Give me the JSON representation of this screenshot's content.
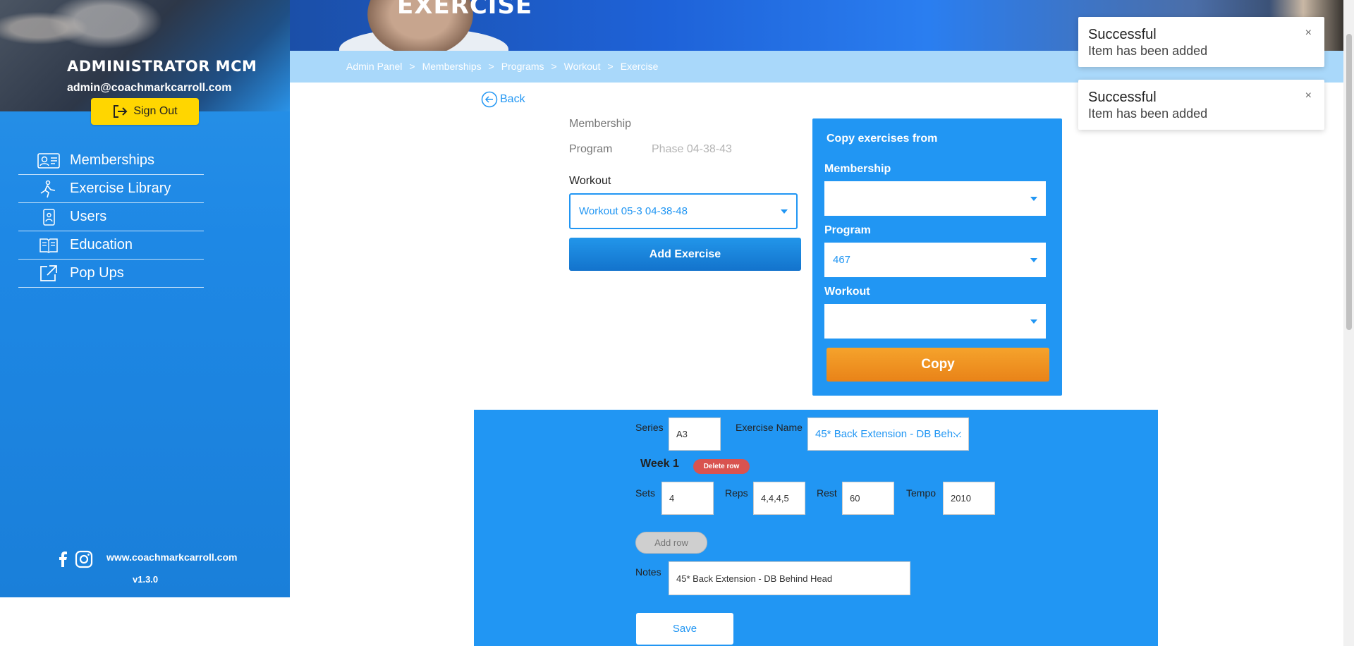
{
  "sidebar": {
    "admin_name": "ADMINISTRATOR MCM",
    "admin_email": "admin@coachmarkcarroll.com",
    "signout_label": "Sign Out",
    "items": [
      {
        "label": "Memberships",
        "icon": "id-card-icon"
      },
      {
        "label": "Exercise Library",
        "icon": "runner-icon"
      },
      {
        "label": "Users",
        "icon": "user-icon"
      },
      {
        "label": "Education",
        "icon": "book-icon"
      },
      {
        "label": "Pop Ups",
        "icon": "external-link-icon"
      }
    ],
    "site_url": "www.coachmarkcarroll.com",
    "version": "v1.3.0"
  },
  "header": {
    "title": "EXERCISE",
    "breadcrumb": [
      "Admin Panel",
      "Memberships",
      "Programs",
      "Workout",
      "Exercise"
    ],
    "breadcrumb_sep": ">"
  },
  "back_label": "Back",
  "form": {
    "membership_label": "Membership",
    "program_label": "Program",
    "program_value": "Phase 04-38-43",
    "workout_label": "Workout",
    "workout_value": "Workout 05-3 04-38-48",
    "add_exercise_label": "Add Exercise"
  },
  "copy_panel": {
    "title": "Copy exercises from",
    "membership_label": "Membership",
    "membership_value": "",
    "program_label": "Program",
    "program_value": "467",
    "workout_label": "Workout",
    "workout_value": "",
    "copy_label": "Copy"
  },
  "exercise": {
    "series_label": "Series",
    "series_value": "A3",
    "name_label": "Exercise Name",
    "name_value": "45* Back Extension - DB Beh...",
    "week_label": "Week 1",
    "delete_row_label": "Delete row",
    "sets_label": "Sets",
    "sets_value": "4",
    "reps_label": "Reps",
    "reps_value": "4,4,4,5",
    "rest_label": "Rest",
    "rest_value": "60",
    "tempo_label": "Tempo",
    "tempo_value": "2010",
    "add_row_label": "Add row",
    "notes_label": "Notes",
    "notes_value": "45* Back Extension - DB Behind Head",
    "save_label": "Save"
  },
  "toasts": [
    {
      "title": "Successful",
      "message": "Item has been added",
      "close": "×"
    },
    {
      "title": "Successful",
      "message": "Item has been added",
      "close": "×"
    }
  ],
  "colors": {
    "primary": "#2196f3",
    "signout": "#ffd600",
    "copy_button": "#f08a1c",
    "delete_row": "#d9534f",
    "breadcrumb_bar": "#a9d8fa"
  }
}
